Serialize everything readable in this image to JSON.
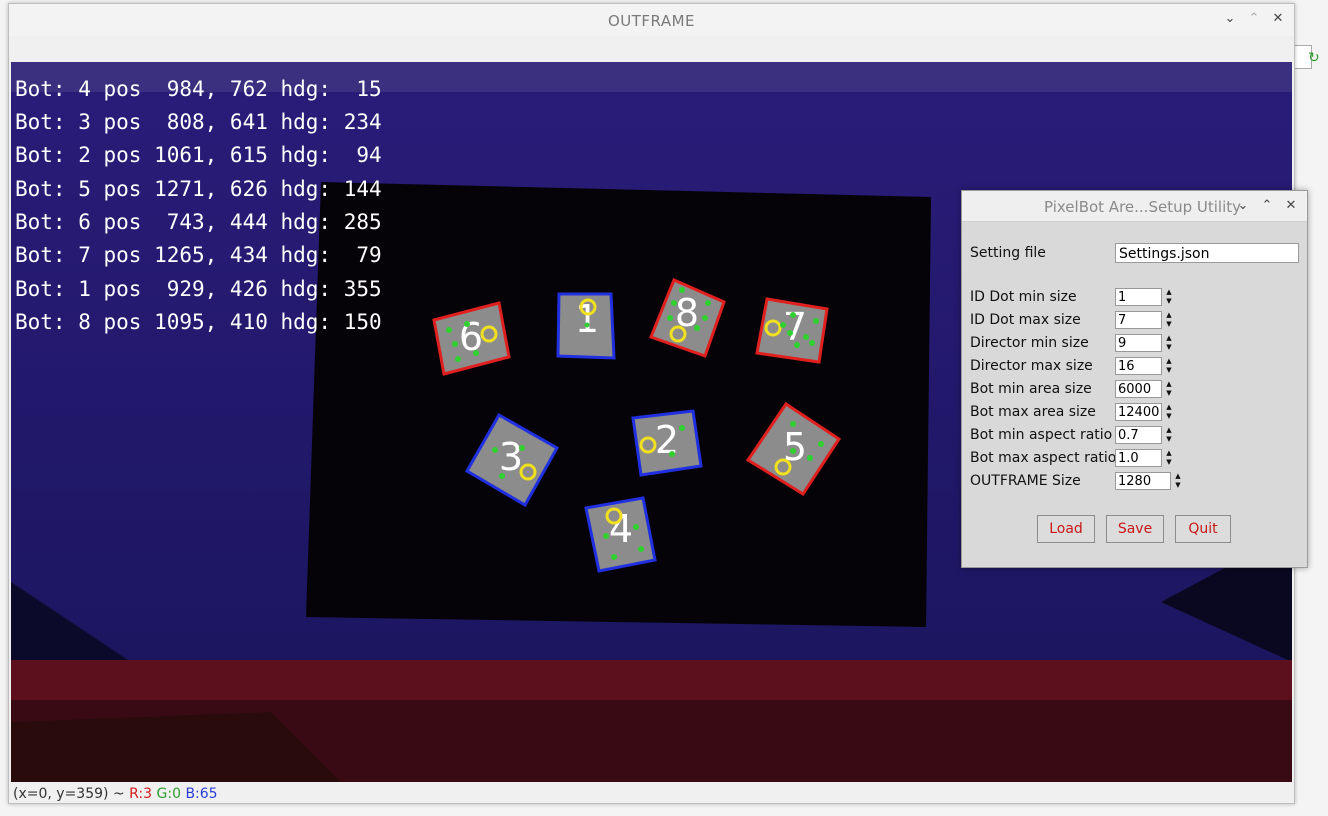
{
  "outframe": {
    "title": "OUTFRAME",
    "status": {
      "coords": "(x=0, y=359) ~",
      "r": "R:3",
      "g": "G:0",
      "b": "B:65"
    },
    "bot_readout": [
      "Bot: 4 pos  984, 762 hdg:  15",
      "Bot: 3 pos  808, 641 hdg: 234",
      "Bot: 2 pos 1061, 615 hdg:  94",
      "Bot: 5 pos 1271, 626 hdg: 144",
      "Bot: 6 pos  743, 444 hdg: 285",
      "Bot: 7 pos 1265, 434 hdg:  79",
      "Bot: 1 pos  929, 426 hdg: 355",
      "Bot: 8 pos 1095, 410 hdg: 150"
    ],
    "bot_markers": [
      {
        "id": "6",
        "outline": "red"
      },
      {
        "id": "1",
        "outline": "blue"
      },
      {
        "id": "8",
        "outline": "red"
      },
      {
        "id": "7",
        "outline": "red"
      },
      {
        "id": "3",
        "outline": "blue"
      },
      {
        "id": "2",
        "outline": "blue"
      },
      {
        "id": "5",
        "outline": "red"
      },
      {
        "id": "4",
        "outline": "blue"
      }
    ]
  },
  "setup": {
    "title": "PixelBot Are...Setup Utility",
    "setting_file_label": "Setting file",
    "setting_file_value": "Settings.json",
    "params": [
      {
        "label": "ID Dot min size",
        "value": "1"
      },
      {
        "label": "ID Dot max size",
        "value": "7"
      },
      {
        "label": "Director min size",
        "value": "9"
      },
      {
        "label": "Director max size",
        "value": "16"
      },
      {
        "label": "Bot min area size",
        "value": "6000"
      },
      {
        "label": "Bot max area size",
        "value": "12400"
      },
      {
        "label": "Bot min aspect ratio",
        "value": "0.7"
      },
      {
        "label": "Bot max aspect ratio",
        "value": "1.0"
      },
      {
        "label": "OUTFRAME Size",
        "value": "1280"
      }
    ],
    "buttons": {
      "load": "Load",
      "save": "Save",
      "quit": "Quit"
    }
  },
  "colors": {
    "marker_red": "#e0201e",
    "marker_blue": "#2030e0",
    "button_text": "#c81818",
    "overlay_text": "#ffffff"
  },
  "icons": [
    "minimize-icon",
    "maximize-icon",
    "close-icon",
    "spin-up-icon",
    "spin-down-icon"
  ]
}
